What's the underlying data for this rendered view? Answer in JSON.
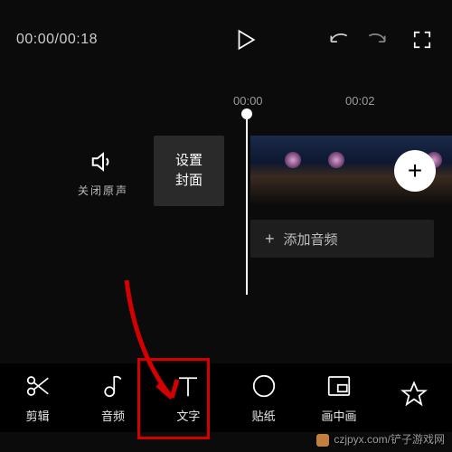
{
  "timecode": "00:00/00:18",
  "ruler": {
    "t0": "00:00",
    "t2": "00:02"
  },
  "soundLabel": "关闭原声",
  "cover": {
    "line1": "设置",
    "line2": "封面"
  },
  "addAudio": "添加音频",
  "tools": [
    {
      "name": "cut",
      "label": "剪辑"
    },
    {
      "name": "audio",
      "label": "音频"
    },
    {
      "name": "text",
      "label": "文字"
    },
    {
      "name": "sticker",
      "label": "贴纸"
    },
    {
      "name": "pip",
      "label": "画中画"
    }
  ],
  "watermark": "czjpyx.com/铲子游戏网"
}
